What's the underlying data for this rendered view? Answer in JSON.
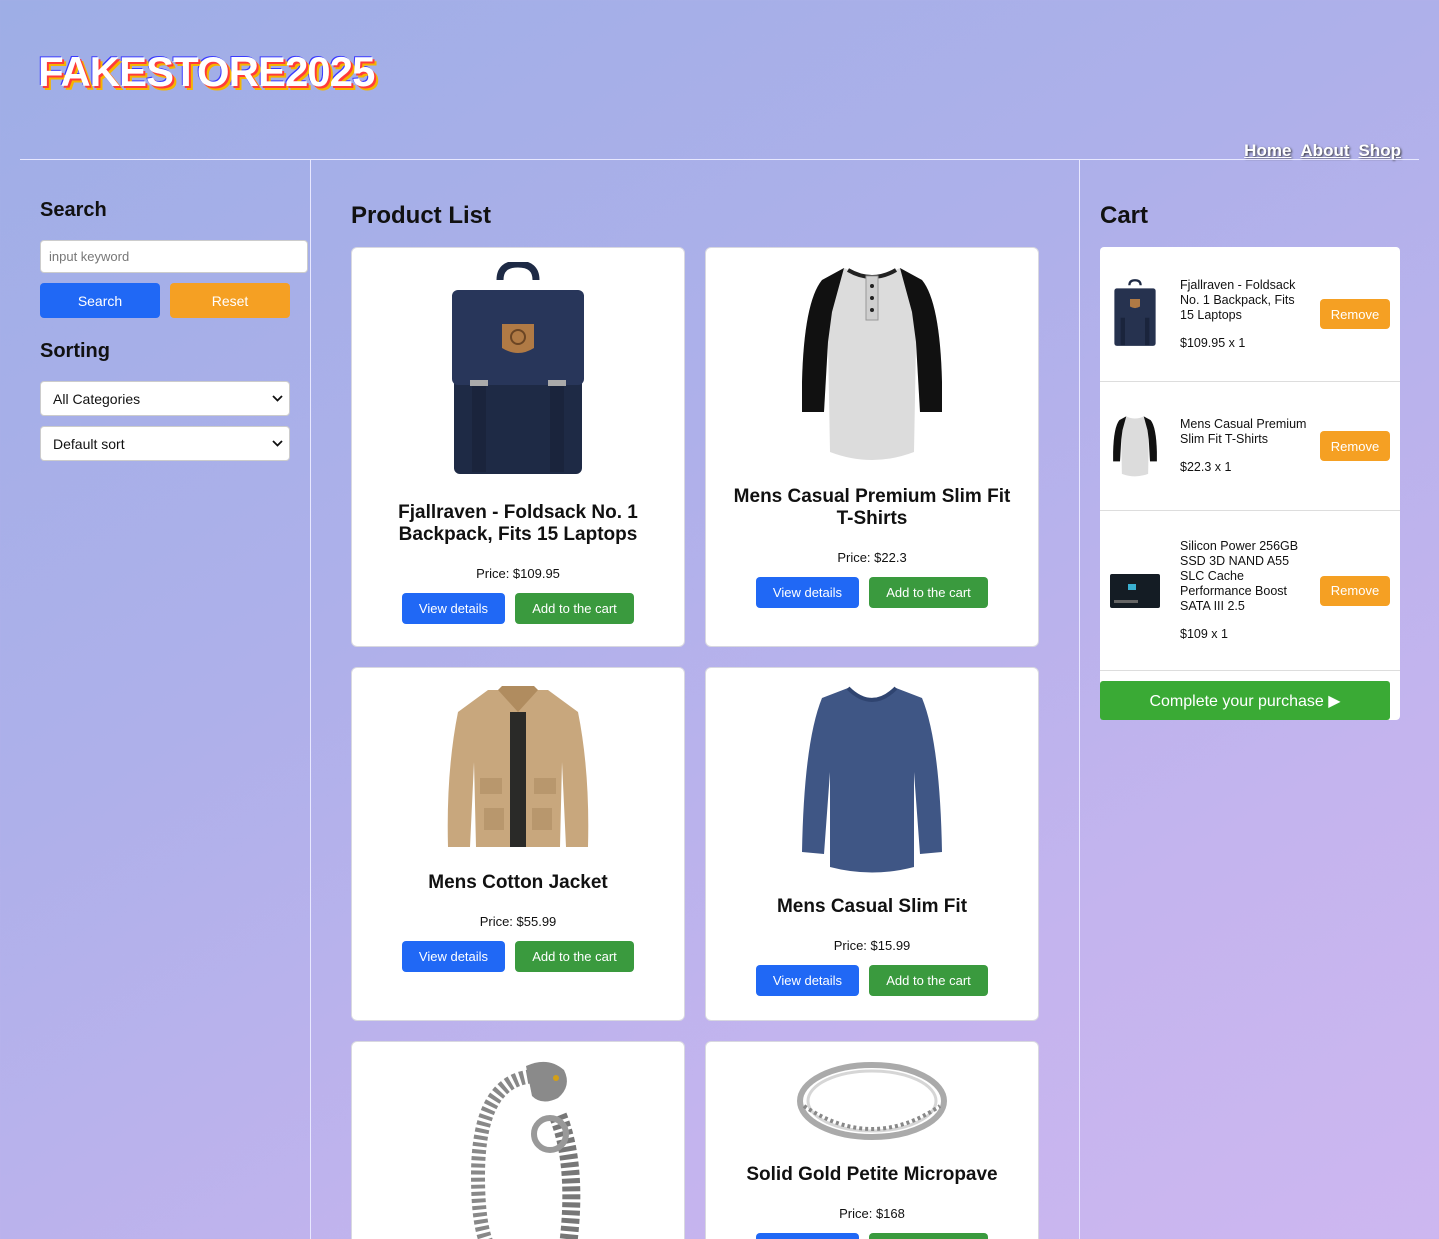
{
  "header": {
    "logo": "FAKESTORE2025",
    "nav": [
      "Home",
      "About",
      "Shop"
    ]
  },
  "sidebar": {
    "search_title": "Search",
    "search_placeholder": "input keyword",
    "search_button": "Search",
    "reset_button": "Reset",
    "sorting_title": "Sorting",
    "category_select": "All Categories",
    "sort_select": "Default sort"
  },
  "products": {
    "title": "Product List",
    "items": [
      {
        "title": "Fjallraven - Foldsack No. 1 Backpack, Fits 15 Laptops",
        "price": "Price: $109.95",
        "image": "backpack"
      },
      {
        "title": "Mens Casual Premium Slim Fit T-Shirts",
        "price": "Price: $22.3",
        "image": "raglan-tshirt"
      },
      {
        "title": "Mens Cotton Jacket",
        "price": "Price: $55.99",
        "image": "jacket"
      },
      {
        "title": "Mens Casual Slim Fit",
        "price": "Price: $15.99",
        "image": "longsleeve-shirt"
      },
      {
        "title": "",
        "price": "",
        "image": "dragon-bracelet"
      },
      {
        "title": "Solid Gold Petite Micropave",
        "price": "Price: $168",
        "image": "ring"
      }
    ],
    "view_label": "View details",
    "add_label": "Add to the cart"
  },
  "cart": {
    "title": "Cart",
    "items": [
      {
        "name": "Fjallraven - Foldsack No. 1 Backpack, Fits 15 Laptops",
        "qty": "$109.95 x 1"
      },
      {
        "name": "Mens Casual Premium Slim Fit T-Shirts",
        "qty": "$22.3 x 1"
      },
      {
        "name": "Silicon Power 256GB SSD 3D NAND A55 SLC Cache Performance Boost SATA III 2.5",
        "qty": "$109 x 1"
      }
    ],
    "remove_label": "Remove",
    "purchase_label": "Complete your purchase ▶"
  },
  "colors": {
    "primary": "#2068f5",
    "warning": "#f5a023",
    "success": "#3a9a3e",
    "purchase": "#3aaa35"
  }
}
